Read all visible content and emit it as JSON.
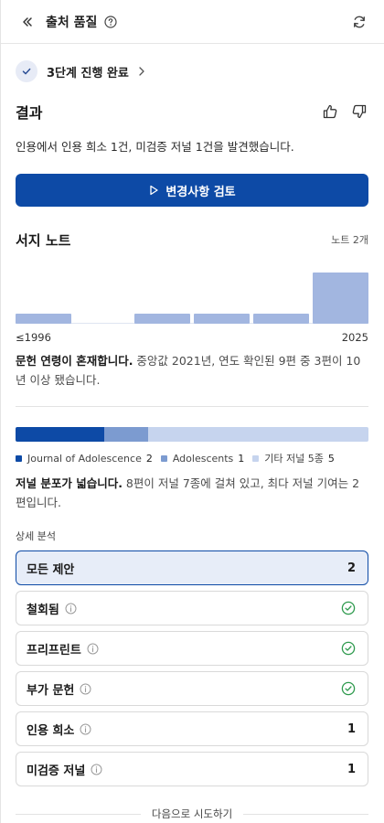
{
  "header": {
    "title": "출처 품질"
  },
  "progress": {
    "label": "3단계 진행 완료"
  },
  "result": {
    "title": "결과",
    "summary": "인용에서 인용 희소 1건, 미검증 저널 1건을 발견했습니다."
  },
  "review_button": {
    "label": "변경사항 검토"
  },
  "notes": {
    "title": "서지 노트",
    "count": "노트 2개",
    "histogram": {
      "x_start": "≤1996",
      "x_end": "2025",
      "bins": [
        1,
        0,
        1,
        1,
        1,
        5
      ]
    },
    "age_bold": "문헌 연령이 혼재합니다.",
    "age_text": " 중앙값 2021년, 연도 확인된 9편 중 3편이 10년 이상 됐습니다."
  },
  "journals": {
    "segments": [
      {
        "name": "Journal of Adolescence",
        "count": "2",
        "value": 2,
        "color": "#0d4aa6"
      },
      {
        "name": "Adolescents",
        "count": "1",
        "value": 1,
        "color": "#7c9bd0"
      },
      {
        "name": "기타 저널 5종",
        "count": "5",
        "value": 5,
        "color": "#c6d4ee"
      }
    ],
    "spread_bold": "저널 분포가 넓습니다.",
    "spread_text": " 8편이 저널 7종에 걸쳐 있고, 최다 저널 기여는 2편입니다."
  },
  "breakdown": {
    "label": "상세 분석",
    "all": {
      "label": "모든 제안",
      "value": "2"
    },
    "items": [
      {
        "label": "철회됨",
        "value": ""
      },
      {
        "label": "프리프린트",
        "value": ""
      },
      {
        "label": "부가 문헌",
        "value": ""
      },
      {
        "label": "인용 희소",
        "value": "1"
      },
      {
        "label": "미검증 저널",
        "value": "1"
      }
    ]
  },
  "footer": {
    "next_try": "다음으로 시도하기"
  }
}
